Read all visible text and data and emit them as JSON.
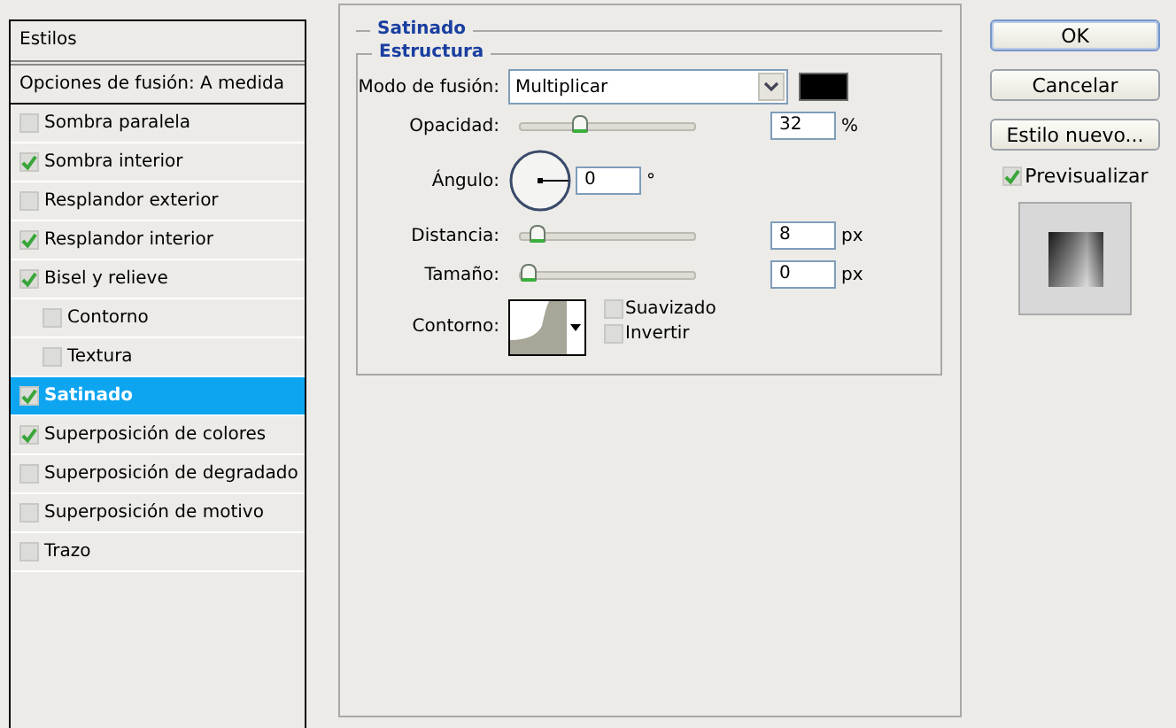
{
  "styles_panel": {
    "header": "Estilos",
    "blend_options": "Opciones de fusión: A medida",
    "items": [
      {
        "label": "Sombra paralela",
        "checked": false,
        "selected": false
      },
      {
        "label": "Sombra interior",
        "checked": true,
        "selected": false
      },
      {
        "label": "Resplandor exterior",
        "checked": false,
        "selected": false
      },
      {
        "label": "Resplandor interior",
        "checked": true,
        "selected": false
      },
      {
        "label": "Bisel y relieve",
        "checked": true,
        "selected": false,
        "children": [
          {
            "label": "Contorno",
            "checked": false,
            "selected": false
          },
          {
            "label": "Textura",
            "checked": false,
            "selected": false
          }
        ]
      },
      {
        "label": "Satinado",
        "checked": true,
        "selected": true
      },
      {
        "label": "Superposición de colores",
        "checked": true,
        "selected": false
      },
      {
        "label": "Superposición de degradado",
        "checked": false,
        "selected": false
      },
      {
        "label": "Superposición de motivo",
        "checked": false,
        "selected": false
      },
      {
        "label": "Trazo",
        "checked": false,
        "selected": false
      }
    ]
  },
  "section": {
    "title": "Satinado",
    "group_title": "Estructura",
    "blend_mode": {
      "label": "Modo de fusión:",
      "value": "Multiplicar"
    },
    "opacity": {
      "label": "Opacidad:",
      "level": 0.32,
      "value": "32",
      "unit": "%"
    },
    "angle": {
      "label": "Ángulo:",
      "value": "0",
      "unit": "°"
    },
    "distance": {
      "label": "Distancia:",
      "level": 0.06,
      "value": "8",
      "unit": "px"
    },
    "size": {
      "label": "Tamaño:",
      "level": 0,
      "value": "0",
      "unit": "px"
    },
    "contour": {
      "label": "Contorno:"
    },
    "options": [
      {
        "label": "Suavizado",
        "checked": false
      },
      {
        "label": "Invertir",
        "checked": false
      }
    ]
  },
  "buttons": [
    {
      "label": "OK",
      "default": true
    },
    {
      "label": "Cancelar",
      "default": false
    },
    {
      "label": "Estilo nuevo...",
      "default": false
    }
  ],
  "preview": {
    "label": "Previsualizar",
    "checked": true
  }
}
